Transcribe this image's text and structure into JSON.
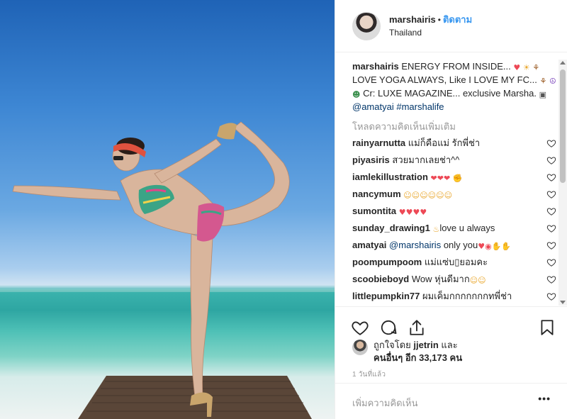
{
  "post": {
    "username": "marshairis",
    "follow_label": "ติดตาม",
    "separator": "•",
    "location": "Thailand"
  },
  "caption": {
    "username": "marshairis",
    "text_parts": [
      "ENERGY FROM INSIDE...",
      "LOVE YOGA ALWAYS, Like I LOVE MY FC...",
      "Cr: LUXE MAGAZINE... exclusive Marsha.",
      "@amatyai",
      "#marshalife"
    ]
  },
  "load_more_label": "โหลดความคิดเห็นเพิ่มเติม",
  "comments": [
    {
      "user": "rainyarnutta",
      "text": "แม่ก็คือแม่ รักพี่ช่า"
    },
    {
      "user": "piyasiris",
      "text": "สวยมากเลยช่า^^"
    },
    {
      "user": "iamlekillustration",
      "text": ""
    },
    {
      "user": "nancymum",
      "text": ""
    },
    {
      "user": "sumontita",
      "text": ""
    },
    {
      "user": "sunday_drawing1",
      "text": "love u always"
    },
    {
      "user": "amatyai",
      "mention": "@marshairis",
      "text": "only you"
    },
    {
      "user": "poompumpoom",
      "text": "แม่แซ่บ▯ยอมคะ"
    },
    {
      "user": "scoobieboyd",
      "text": "Wow หุ่นดีมาก"
    },
    {
      "user": "littlepumpkin77",
      "text": "ผมเค็มกกกกกกกทพี่ช่า"
    }
  ],
  "likes": {
    "liked_by_prefix": "ถูกใจโดย",
    "liked_by_user": "jjetrin",
    "and": "และ",
    "others_line": "คนอื่นๆ อีก 33,173 คน"
  },
  "timestamp": "1 วันที่แล้ว",
  "add_comment_placeholder": "เพิ่มความคิดเห็น",
  "more_label": "•••",
  "icons": {
    "heart": "heart-icon",
    "comment": "comment-icon",
    "share": "share-icon",
    "bookmark": "bookmark-icon"
  },
  "colors": {
    "link": "#3897f0",
    "text": "#262626",
    "muted": "#999999",
    "heart_red": "#ed4956"
  }
}
